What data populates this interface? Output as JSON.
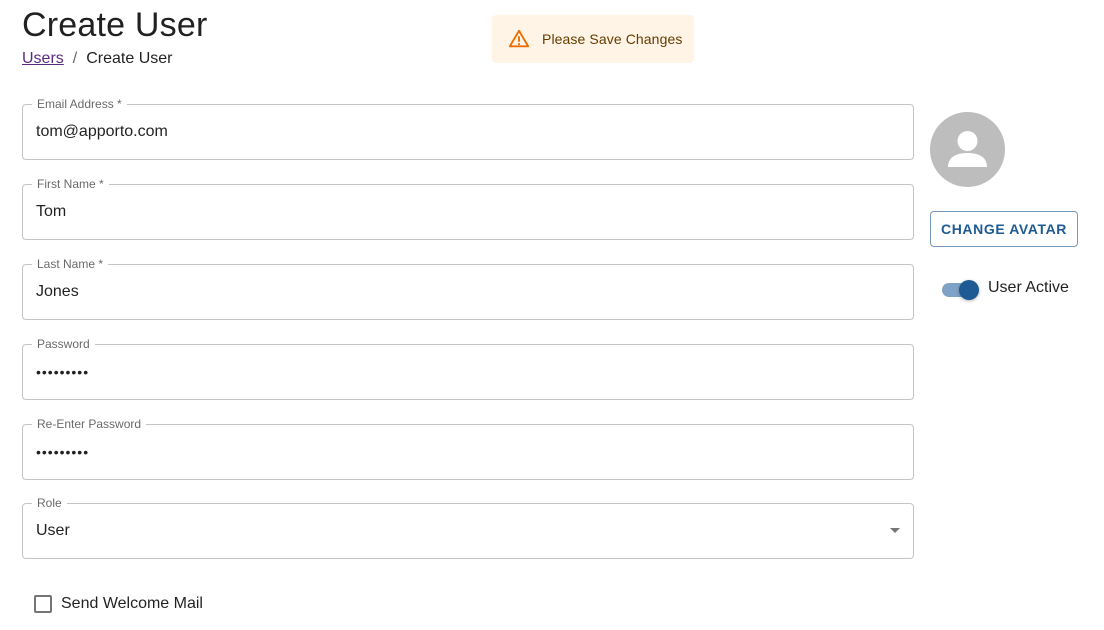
{
  "header": {
    "title": "Create User",
    "breadcrumb": {
      "link": "Users",
      "separator": "/",
      "current": "Create User"
    }
  },
  "alert": {
    "message": "Please Save Changes",
    "icon": "warning-icon",
    "color": "#ed6c02"
  },
  "form": {
    "email": {
      "label": "Email Address *",
      "value": "tom@apporto.com"
    },
    "first_name": {
      "label": "First Name *",
      "value": "Tom"
    },
    "last_name": {
      "label": "Last Name *",
      "value": "Jones"
    },
    "password": {
      "label": "Password",
      "value": "•••••••••"
    },
    "reenter_password": {
      "label": "Re-Enter Password",
      "value": "•••••••••"
    },
    "role": {
      "label": "Role",
      "value": "User"
    },
    "welcome_mail": {
      "label": "Send Welcome Mail",
      "checked": false
    }
  },
  "side": {
    "avatar_icon": "person-icon",
    "change_avatar_label": "CHANGE AVATAR",
    "user_active": {
      "label": "User Active",
      "on": true
    }
  },
  "colors": {
    "primary": "#1e5a93",
    "link": "#5e2a84",
    "alert_bg": "#fff4e5",
    "alert_text": "#663c00"
  }
}
